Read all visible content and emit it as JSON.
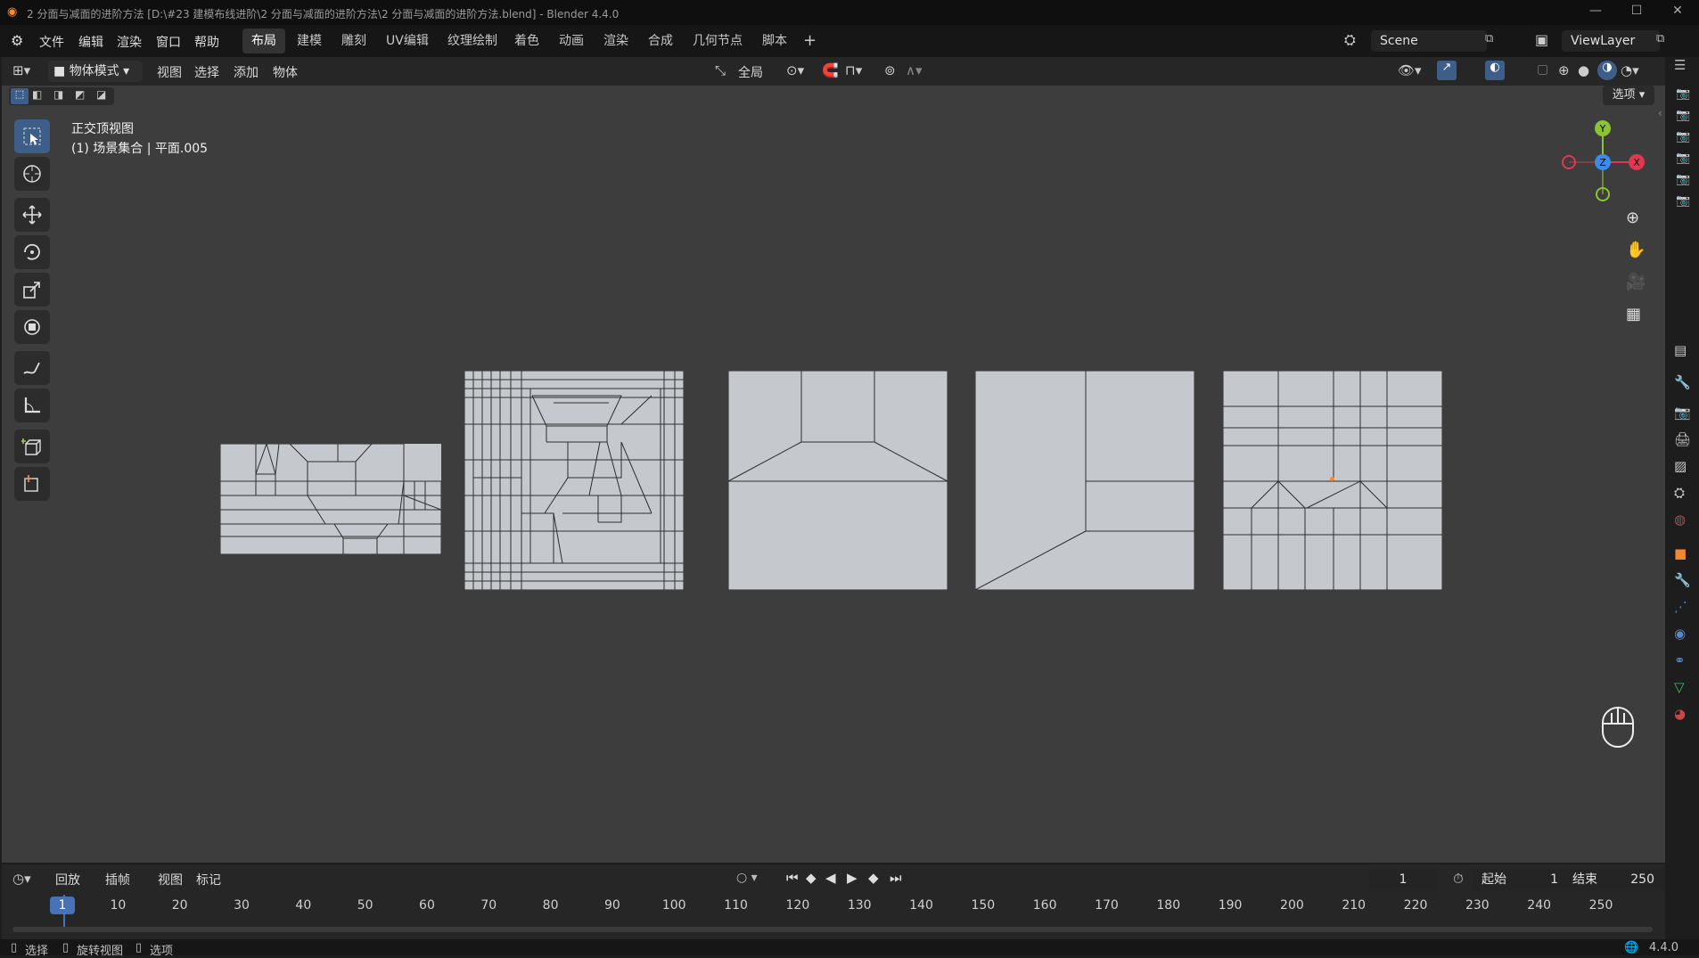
{
  "titlebar": {
    "title": "2 分面与减面的进阶方法 [D:\\#23 建模布线进阶\\2 分面与减面的进阶方法\\2 分面与减面的进阶方法.blend] - Blender 4.4.0",
    "minimize": "—",
    "maximize": "☐",
    "close": "✕"
  },
  "menubar": {
    "items": [
      "文件",
      "编辑",
      "渲染",
      "窗口",
      "帮助"
    ],
    "workspaces": [
      "布局",
      "建模",
      "雕刻",
      "UV编辑",
      "纹理绘制",
      "着色",
      "动画",
      "渲染",
      "合成",
      "几何节点",
      "脚本"
    ],
    "add_workspace": "+",
    "scene": "Scene",
    "view_layer": "ViewLayer"
  },
  "viewport_header": {
    "mode": "物体模式",
    "menus": [
      "视图",
      "选择",
      "添加",
      "物体"
    ],
    "transform_orientation": "全局",
    "options": "选项"
  },
  "viewport": {
    "view_name": "正交顶视图",
    "collection_info": "(1) 场景集合 | 平面.005",
    "gizmo": {
      "x": "X",
      "y": "Y",
      "z": "Z"
    }
  },
  "toolbar": {
    "tools": [
      "select-box-icon",
      "cursor-icon",
      "move-icon",
      "rotate-icon",
      "scale-icon",
      "transform-icon",
      "annotate-icon",
      "measure-icon",
      "add-cube-icon",
      "add-mesh-icon"
    ]
  },
  "timeline": {
    "menus": [
      "回放",
      "插帧",
      "视图",
      "标记"
    ],
    "current_frame": "1",
    "start_label": "起始",
    "start": "1",
    "end_label": "结束",
    "end": "250",
    "ticks": [
      "1",
      "10",
      "20",
      "30",
      "40",
      "50",
      "60",
      "70",
      "80",
      "90",
      "100",
      "110",
      "120",
      "130",
      "140",
      "150",
      "160",
      "170",
      "180",
      "190",
      "200",
      "210",
      "220",
      "230",
      "240",
      "250"
    ]
  },
  "statusbar": {
    "select": "选择",
    "rotate_view": "旋转视图",
    "options": "选项",
    "version": "4.4.0"
  },
  "colors": {
    "viewport_bg": "#3d3d3d",
    "mesh_face": "#c5c8cc",
    "mesh_edge": "#2e2e2e",
    "active_tool": "#3e5e8a",
    "current_frame": "#4772b3",
    "axis_x": "#e2384f",
    "axis_y": "#8bc431",
    "axis_z": "#3b8beb"
  }
}
